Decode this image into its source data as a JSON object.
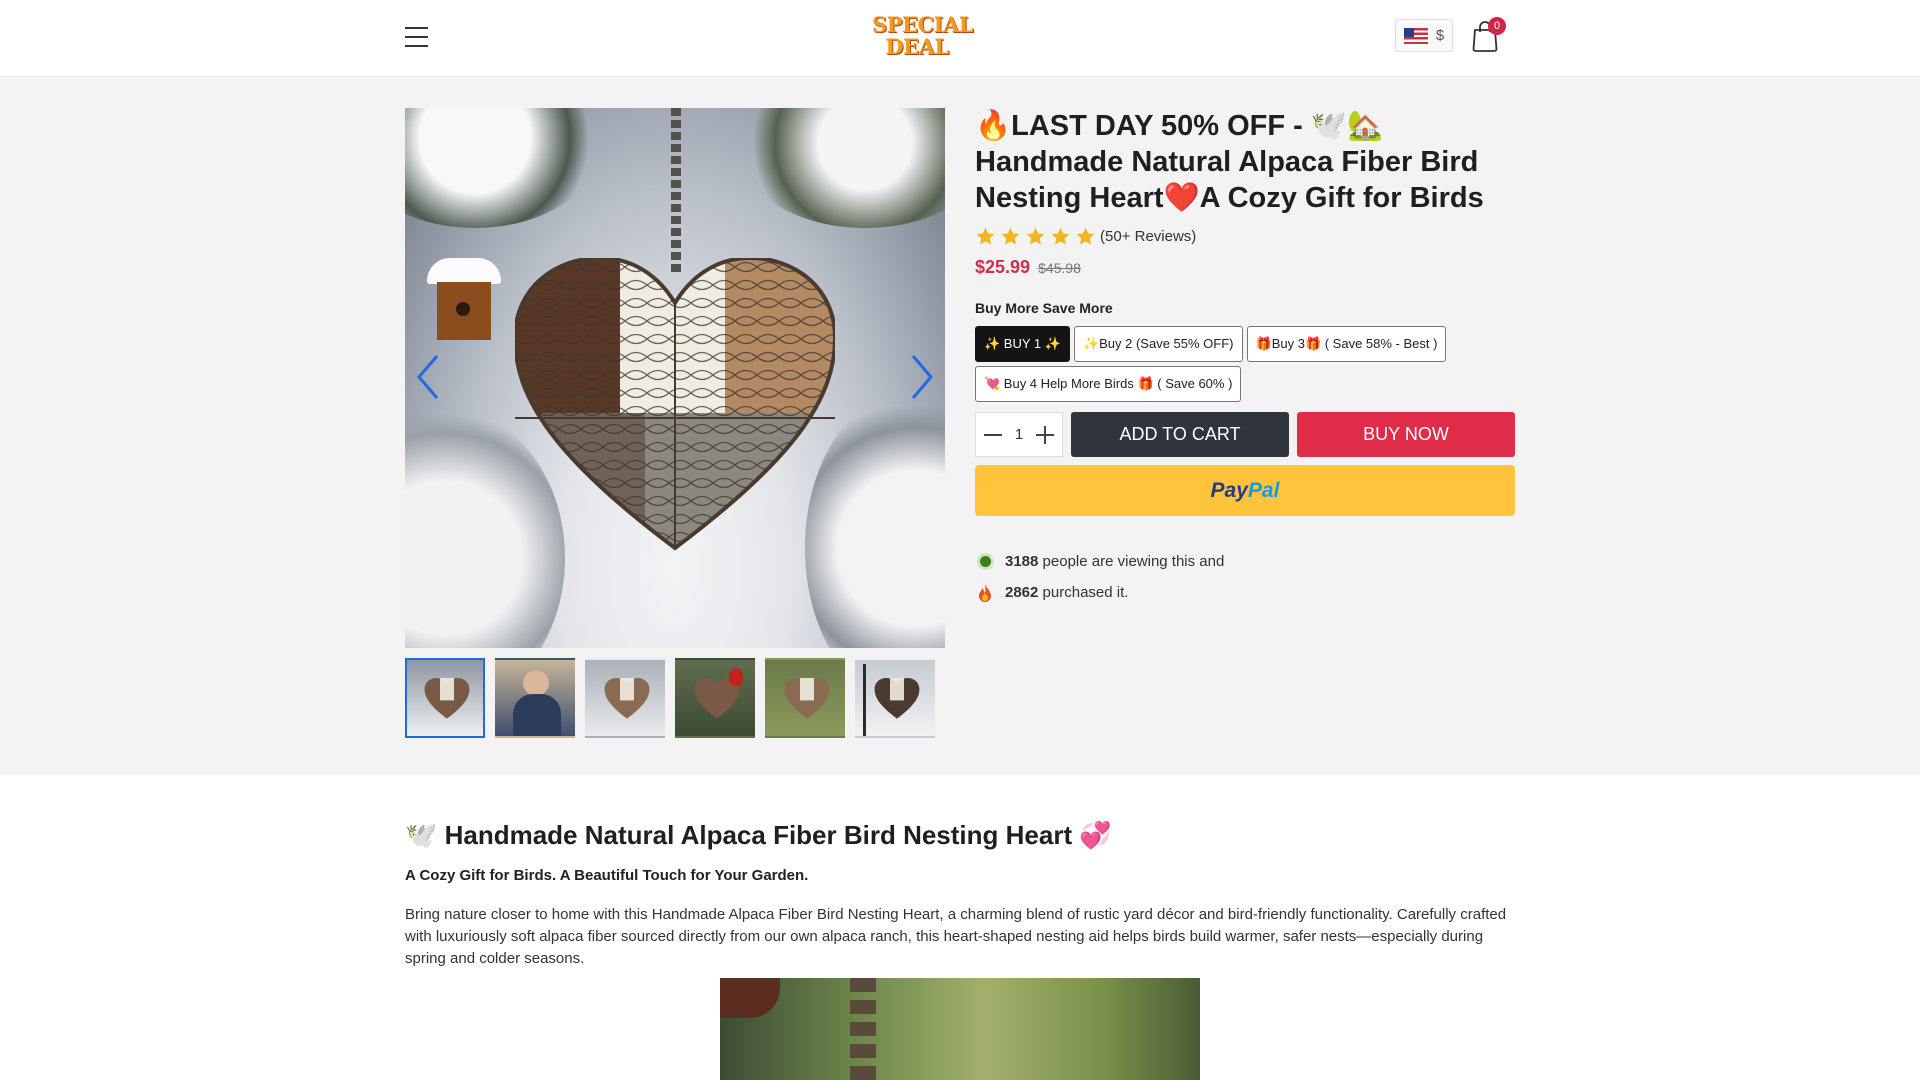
{
  "header": {
    "logo_text_line1": "SPECIAL",
    "logo_text_line2": "DEAL",
    "currency_symbol": "$",
    "cart_count": "0"
  },
  "product": {
    "title": "🔥LAST DAY 50% OFF - 🕊️🏡 Handmade Natural Alpaca Fiber Bird Nesting Heart❤️A Cozy Gift for Birds",
    "rating_stars": 5,
    "reviews_label": "(50+ Reviews)",
    "price": "$25.99",
    "compare_price": "$45.98",
    "options_title": "Buy More Save More",
    "options": [
      {
        "label": "✨ BUY 1 ✨",
        "selected": true
      },
      {
        "label": "✨Buy 2 (Save 55% OFF)",
        "selected": false
      },
      {
        "label": "🎁Buy 3🎁 ( Save 58% - Best )",
        "selected": false
      },
      {
        "label": "💘 Buy 4 Help More Birds 🎁 ( Save 60% )",
        "selected": false
      }
    ],
    "quantity": "1",
    "add_to_cart_label": "ADD TO CART",
    "buy_now_label": "BUY NOW",
    "paypal_part1": "Pay",
    "paypal_part2": "Pal",
    "viewing_count": "3188",
    "viewing_text": "people are viewing this and",
    "purchased_count": "2862",
    "purchased_text": "purchased it."
  },
  "gallery": {
    "thumbnail_count": 6,
    "active_index": 0
  },
  "description": {
    "heading": "🕊️ Handmade Natural Alpaca Fiber Bird Nesting Heart 💞",
    "subheading": "A Cozy Gift for Birds. A Beautiful Touch for Your Garden.",
    "paragraph": "Bring nature closer to home with this Handmade Alpaca Fiber Bird Nesting Heart, a charming blend of rustic yard décor and bird-friendly functionality. Carefully crafted with luxuriously soft alpaca fiber sourced directly from our own alpaca ranch, this heart-shaped nesting aid helps birds build warmer, safer nests—especially during spring and colder seasons."
  },
  "colors": {
    "accent_red": "#df2d49",
    "price_red": "#d12f4c",
    "dark_button": "#30343d",
    "paypal_yellow": "#ffc43c",
    "star_gold": "#f2b51f",
    "active_thumb_border": "#1e6be0"
  }
}
